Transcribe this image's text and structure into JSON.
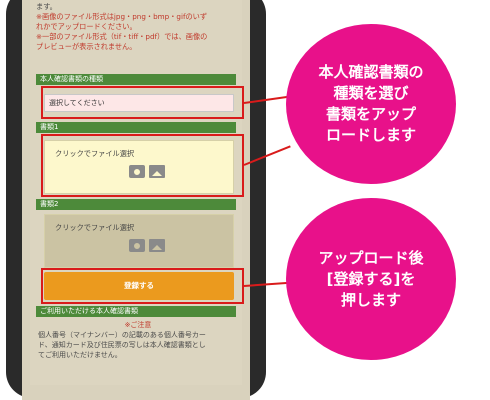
{
  "screen": {
    "intro_line1": "ます。",
    "intro_line2": "※画像のファイル形式はjpg・png・bmp・gifのいず",
    "intro_line3": "れかでアップロードください。",
    "intro_line4": "※一部のファイル形式（tif・tiff・pdf）では、画像の",
    "intro_line5": "プレビューが表示されません。",
    "doc_type_header": "本人確認書類の種類",
    "select_value": "選択してください",
    "doc1_header": "書類1",
    "doc1_upload_label": "クリックでファイル選択",
    "doc2_header": "書類2",
    "doc2_upload_label": "クリックでファイル選択",
    "submit_label": "登録する",
    "notes_header": "ご利用いただける本人確認書類",
    "notes_warning": "※ご注意",
    "notes_line1": "個人番号（マイナンバー）の記載のある個人番号カー",
    "notes_line2": "ド、通知カード及び住民票の写しは本人確認書類とし",
    "notes_line3": "てご利用いただけません。"
  },
  "callouts": {
    "top": "本人確認書類の\n種類を選び\n書類をアップ\nロードします",
    "bottom": "アップロード後\n[登録する]を\n押します"
  },
  "colors": {
    "callout": "#e8118a",
    "frame": "#d91b1b",
    "button": "#eb9a1e",
    "section_bar": "#4d8a3a"
  }
}
